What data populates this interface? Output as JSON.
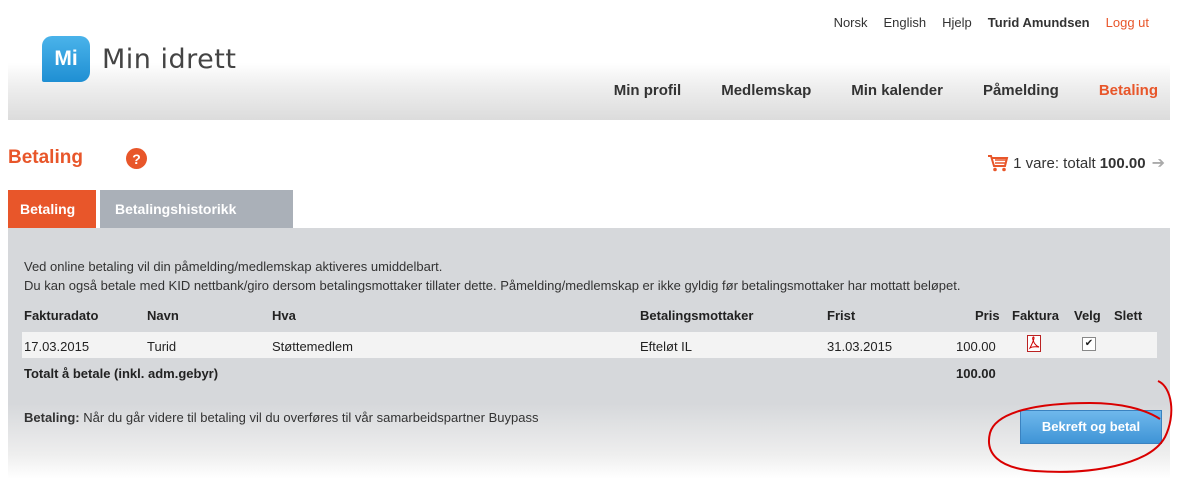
{
  "topnav": {
    "lang_norsk": "Norsk",
    "lang_english": "English",
    "help": "Hjelp",
    "user": "Turid Amundsen",
    "logout": "Logg ut"
  },
  "logo": {
    "badge": "Mi",
    "text": "Min idrett"
  },
  "mainnav": [
    "Min profil",
    "Medlemskap",
    "Min kalender",
    "Påmelding",
    "Betaling"
  ],
  "page": {
    "title": "Betaling",
    "help_icon": "?"
  },
  "cart": {
    "text": "1 vare: totalt",
    "total": "100.00"
  },
  "tabs": [
    "Betaling",
    "Betalingshistorikk"
  ],
  "info": {
    "line1": "Ved online betaling vil din påmelding/medlemskap aktiveres umiddelbart.",
    "line2": "Du kan også betale med KID nettbank/giro dersom betalingsmottaker tillater dette. Påmelding/medlemskap er ikke gyldig før betalingsmottaker har mottatt beløpet."
  },
  "table": {
    "headers": [
      "Fakturadato",
      "Navn",
      "Hva",
      "Betalingsmottaker",
      "Frist",
      "Pris",
      "Faktura",
      "Velg",
      "Slett"
    ],
    "rows": [
      {
        "date": "17.03.2015",
        "name": "Turid",
        "what": "Støttemedlem",
        "receiver": "Efteløt IL",
        "deadline": "31.03.2015",
        "price": "100.00",
        "selected": true
      }
    ],
    "total_label": "Totalt å betale (inkl. adm.gebyr)",
    "total_value": "100.00"
  },
  "payment": {
    "label": "Betaling:",
    "note": "Når du går videre til betaling vil du overføres til vår samarbeidspartner Buypass",
    "button": "Bekreft og betal"
  },
  "colors": {
    "accent": "#e8562a",
    "button": "#4a9ee0",
    "annotation": "#d90000"
  }
}
